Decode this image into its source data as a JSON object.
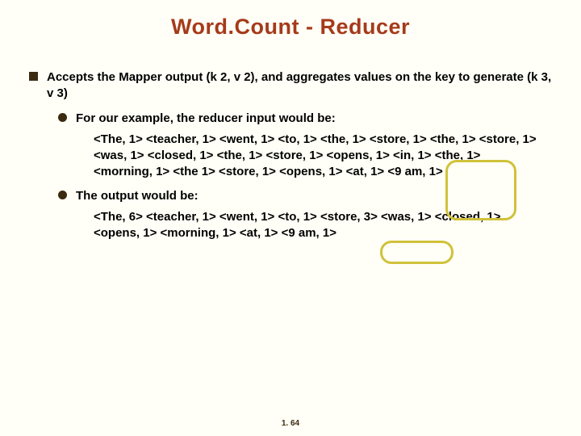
{
  "title": "Word.Count - Reducer",
  "bullets": {
    "lvl1": "Accepts the Mapper output (k 2, v 2), and aggregates values on the key to generate (k 3, v 3)",
    "lvl2a": "For our example, the reducer input would be:",
    "lvl3a": "<The, 1> <teacher, 1> <went, 1> <to, 1> <the, 1> <store, 1> <the, 1> <store, 1> <was, 1> <closed, 1> <the, 1> <store, 1> <opens, 1> <in, 1> <the, 1> <morning, 1> <the 1> <store, 1> <opens, 1> <at, 1> <9 am, 1>",
    "lvl2b": "The output would be:",
    "lvl3b": "<The, 6> <teacher, 1> <went, 1> <to, 1> <store, 3> <was, 1> <closed, 1> <opens, 1> <morning, 1> <at, 1> <9 am, 1>"
  },
  "footer": "1. 64"
}
